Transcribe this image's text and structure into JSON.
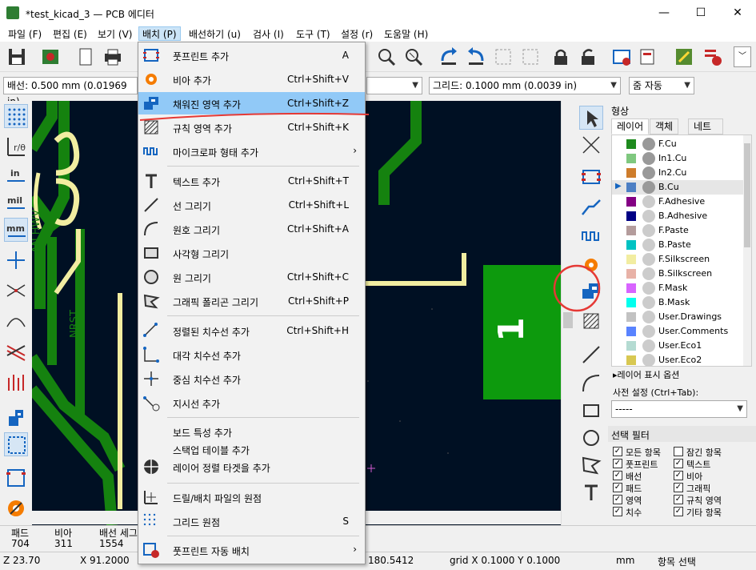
{
  "window": {
    "title": "*test_kicad_3 — PCB 에디터"
  },
  "menubar": {
    "items": [
      "파일 (F)",
      "편집 (E)",
      "보기 (V)",
      "배치 (P)",
      "배선하기 (u)",
      "검사 (I)",
      "도구 (T)",
      "설정 (r)",
      "도움말 (H)"
    ]
  },
  "toolbar2": {
    "track": "배선: 0.500 mm (0.01969 in)",
    "grid": "그리드: 0.1000 mm (0.0039 in)",
    "zoom": "줌 자동"
  },
  "dropdown": {
    "items": [
      {
        "label": "풋프린트 추가",
        "shortcut": "A"
      },
      {
        "label": "비아 추가",
        "shortcut": "Ctrl+Shift+V"
      },
      {
        "label": "채워진 영역 추가",
        "shortcut": "Ctrl+Shift+Z"
      },
      {
        "label": "규칙 영역 추가",
        "shortcut": "Ctrl+Shift+K"
      },
      {
        "label": "마이크로파 형태 추가",
        "shortcut": ""
      },
      {
        "label": "텍스트 추가",
        "shortcut": "Ctrl+Shift+T"
      },
      {
        "label": "선 그리기",
        "shortcut": "Ctrl+Shift+L"
      },
      {
        "label": "원호 그리기",
        "shortcut": "Ctrl+Shift+A"
      },
      {
        "label": "사각형 그리기",
        "shortcut": ""
      },
      {
        "label": "원 그리기",
        "shortcut": "Ctrl+Shift+C"
      },
      {
        "label": "그래픽 폴리곤 그리기",
        "shortcut": "Ctrl+Shift+P"
      },
      {
        "label": "정렬된 치수선 추가",
        "shortcut": "Ctrl+Shift+H"
      },
      {
        "label": "대각 치수선 추가",
        "shortcut": ""
      },
      {
        "label": "중심 치수선 추가",
        "shortcut": ""
      },
      {
        "label": "지시선 추가",
        "shortcut": ""
      },
      {
        "label": "보드 특성 추가",
        "shortcut": ""
      },
      {
        "label": "스택업 테이블 추가",
        "shortcut": ""
      },
      {
        "label": "레이어 정렬 타겟을 추가",
        "shortcut": ""
      },
      {
        "label": "드릴/배치 파일의 원점",
        "shortcut": ""
      },
      {
        "label": "그리드 원점",
        "shortcut": "S"
      },
      {
        "label": "풋프린트 자동 배치",
        "shortcut": ""
      }
    ]
  },
  "panel": {
    "title": "형상",
    "tabs": [
      "레이어",
      "객체",
      "네트"
    ],
    "layers": [
      {
        "name": "F.Cu",
        "color": "#c83434"
      },
      {
        "name": "In1.Cu",
        "color": "#7fc87f"
      },
      {
        "name": "In2.Cu",
        "color": "#ce7d2c"
      },
      {
        "name": "B.Cu",
        "color": "#4d7fc4"
      },
      {
        "name": "F.Adhesive",
        "color": "#840084"
      },
      {
        "name": "B.Adhesive",
        "color": "#000084"
      },
      {
        "name": "F.Paste",
        "color": "#b49c9c"
      },
      {
        "name": "B.Paste",
        "color": "#00c2c2"
      },
      {
        "name": "F.Silkscreen",
        "color": "#f2eda1"
      },
      {
        "name": "B.Silkscreen",
        "color": "#e8b2a7"
      },
      {
        "name": "F.Mask",
        "color": "#d864ff"
      },
      {
        "name": "B.Mask",
        "color": "#02ffee"
      },
      {
        "name": "User.Drawings",
        "color": "#c2c2c2"
      },
      {
        "name": "User.Comments",
        "color": "#5983ff"
      },
      {
        "name": "User.Eco1",
        "color": "#b4dbd2"
      },
      {
        "name": "User.Eco2",
        "color": "#d8c852"
      }
    ],
    "layer_options": "레이어 표시 옵션",
    "preset_label": "사전 설정 (Ctrl+Tab):",
    "preset_value": "-----",
    "filter_title": "선택 필터",
    "filters": [
      {
        "label": "모든 항목",
        "checked": true
      },
      {
        "label": "잠긴 항목",
        "checked": false
      },
      {
        "label": "풋프린트",
        "checked": true
      },
      {
        "label": "텍스트",
        "checked": true
      },
      {
        "label": "배선",
        "checked": true
      },
      {
        "label": "비아",
        "checked": true
      },
      {
        "label": "패드",
        "checked": true
      },
      {
        "label": "그래픽",
        "checked": true
      },
      {
        "label": "영역",
        "checked": true
      },
      {
        "label": "규칙 영역",
        "checked": true
      },
      {
        "label": "치수",
        "checked": true
      },
      {
        "label": "기타 항목",
        "checked": true
      }
    ]
  },
  "canvas": {
    "labels": [
      "AN HWV",
      "NRST"
    ],
    "pad_number": "1"
  },
  "status": {
    "pads_label": "패드",
    "pads_value": "704",
    "vias_label": "비아",
    "vias_value": "311",
    "tracks_label": "배선 세그",
    "tracks_value": "1554",
    "zoom": "Z 23.70",
    "x": "X 91.2000",
    "y_partial": "180.5412",
    "grid": "grid X 0.1000  Y 0.1000",
    "units": "mm",
    "mode": "항목 선택"
  }
}
